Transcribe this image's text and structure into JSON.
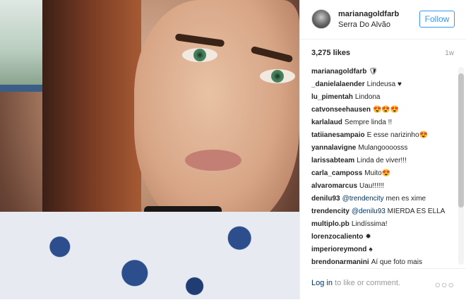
{
  "post": {
    "username": "marianagoldfarb",
    "location": "Serra Do Alvão",
    "follow_label": "Follow",
    "likes": "3,275 likes",
    "time": "1w"
  },
  "comments": [
    {
      "user": "marianagoldfarb",
      "text": "🛡"
    },
    {
      "user": "_danielalaender",
      "text": "Lindeusa ♥"
    },
    {
      "user": "lu_pimentah",
      "text": "Lindona"
    },
    {
      "user": "catvonseehausen",
      "text": "😍😍😍"
    },
    {
      "user": "karlalaud",
      "text": "Sempre linda !!"
    },
    {
      "user": "tatiianesampaio",
      "text": "E esse narizinho😍"
    },
    {
      "user": "yannalavigne",
      "text": "Mulangoooosss"
    },
    {
      "user": "larissabteam",
      "text": "Linda de viver!!!"
    },
    {
      "user": "carla_camposs",
      "text": "Muito😍"
    },
    {
      "user": "alvaromarcus",
      "text": "Uau!!!!!!"
    },
    {
      "user": "denilu93",
      "mention": "@trendencity",
      "text": "men es xime"
    },
    {
      "user": "trendencity",
      "mention": "@denilu93",
      "text": "MIERDA ES ELLA"
    },
    {
      "user": "multiplo.pb",
      "text": "Lindíssima!"
    },
    {
      "user": "lorenzocaliento",
      "text": "✹"
    },
    {
      "user": "imperioreymond",
      "text": "♠"
    },
    {
      "user": "brendonarmanini",
      "text": "Aí que foto mais"
    }
  ],
  "footer": {
    "login_link": "Log in",
    "login_text": " to like or comment.",
    "more_icon": "ellipsis-icon"
  }
}
